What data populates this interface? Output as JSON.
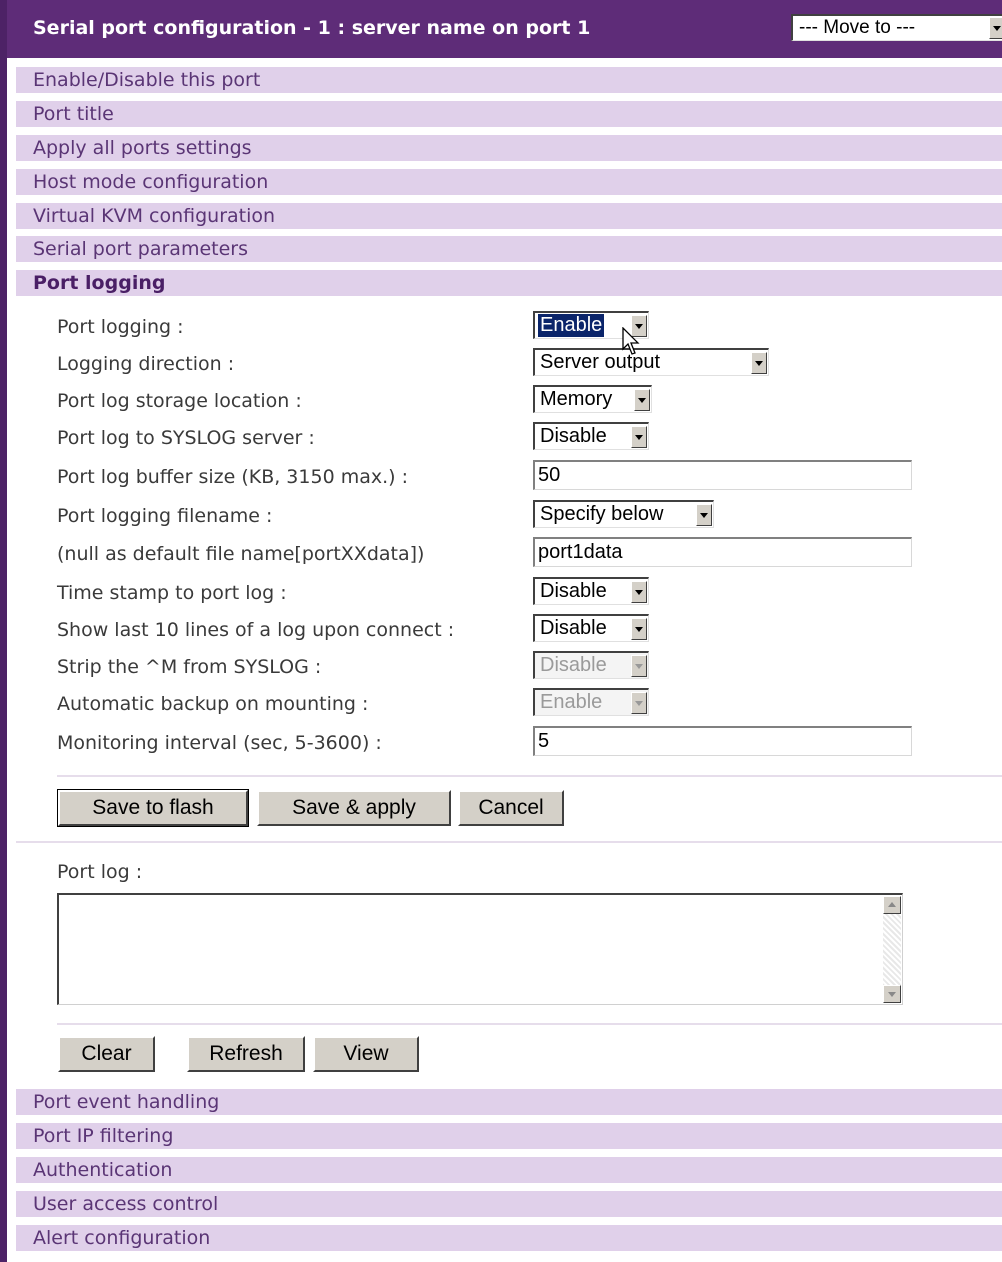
{
  "header": {
    "title": "Serial port configuration - 1 : server name on port 1",
    "move_to": "--- Move to ---"
  },
  "sections_top": [
    "Enable/Disable this port",
    "Port title",
    "Apply all ports settings",
    "Host mode configuration",
    "Virtual KVM configuration",
    "Serial port parameters"
  ],
  "active_section": "Port logging",
  "form": {
    "port_logging": {
      "label": "Port logging :",
      "value": "Enable"
    },
    "logging_direction": {
      "label": "Logging direction :",
      "value": "Server output"
    },
    "storage_location": {
      "label": "Port log storage location :",
      "value": "Memory"
    },
    "syslog": {
      "label": "Port log to SYSLOG server :",
      "value": "Disable"
    },
    "buffer_size": {
      "label": "Port log buffer size (KB, 3150 max.) :",
      "value": "50"
    },
    "filename": {
      "label": "Port logging filename :",
      "value": "Specify below"
    },
    "default_name": {
      "label": "(null as default file name[portXXdata])",
      "value": "port1data"
    },
    "time_stamp": {
      "label": "Time stamp to port log :",
      "value": "Disable"
    },
    "show_last": {
      "label": "Show last 10 lines of a log upon connect :",
      "value": "Disable"
    },
    "strip_m": {
      "label": "Strip the ^M from SYSLOG :",
      "value": "Disable"
    },
    "auto_backup": {
      "label": "Automatic backup on mounting :",
      "value": "Enable"
    },
    "monitoring_interval": {
      "label": "Monitoring interval (sec, 5-3600) :",
      "value": "5"
    }
  },
  "buttons": {
    "save_flash": "Save to flash",
    "save_apply": "Save & apply",
    "cancel": "Cancel",
    "clear": "Clear",
    "refresh": "Refresh",
    "view": "View"
  },
  "port_log": {
    "label": "Port log :",
    "content": ""
  },
  "sections_bottom": [
    "Port event handling",
    "Port IP filtering",
    "Authentication",
    "User access control",
    "Alert configuration"
  ],
  "colors": {
    "header": "#5e2c78",
    "section_bg": "#e0d0ea",
    "selection": "#0a246a"
  }
}
